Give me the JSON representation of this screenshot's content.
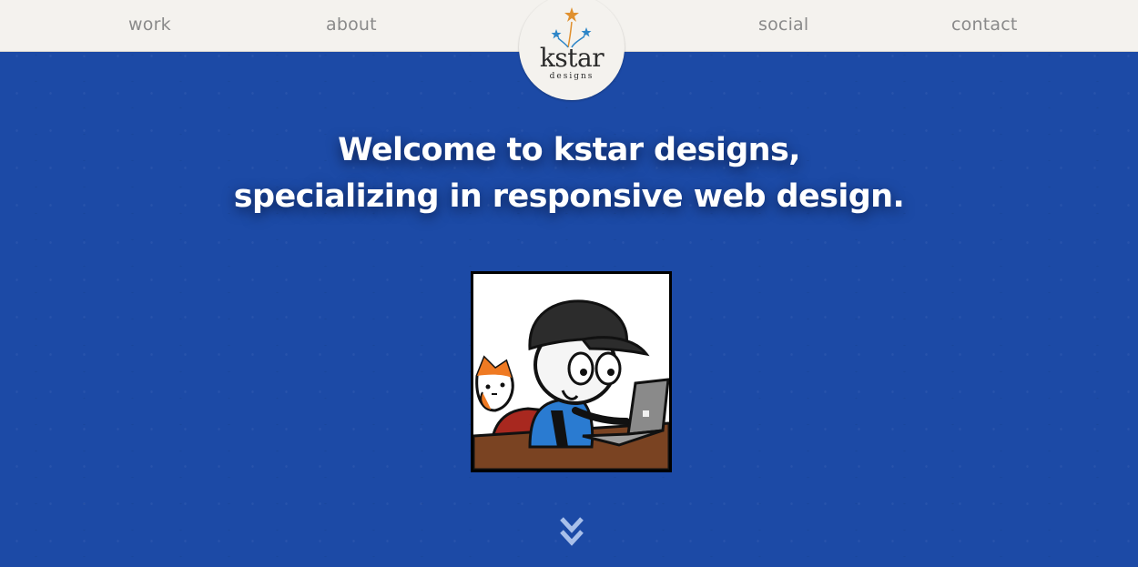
{
  "nav": {
    "items": [
      {
        "label": "work"
      },
      {
        "label": "about"
      },
      {
        "label": "social"
      },
      {
        "label": "contact"
      }
    ]
  },
  "logo": {
    "name": "kstar",
    "tagline": "designs",
    "icon": "fireworks-stars-icon",
    "colors": {
      "orange": "#e0902e",
      "blue": "#2e86c8"
    }
  },
  "hero": {
    "line1": "Welcome to kstar designs,",
    "line2": "specializing in responsive web design.",
    "image_icon": "cartoon-avatar-with-laptop-and-cat",
    "scroll_icon": "double-chevron-down-icon"
  },
  "colors": {
    "background": "#1c4aa6",
    "navbar": "#f4f2ee",
    "nav_text": "#8a8a8a"
  }
}
